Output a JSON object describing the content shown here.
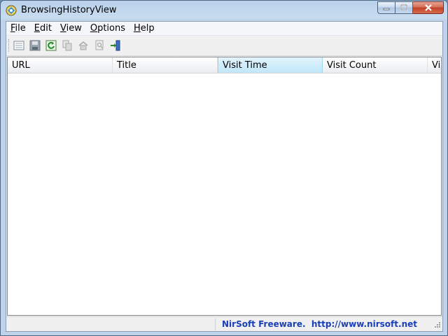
{
  "window": {
    "title": "BrowsingHistoryView"
  },
  "menu": [
    {
      "key": "F",
      "rest": "ile"
    },
    {
      "key": "E",
      "rest": "dit"
    },
    {
      "key": "V",
      "rest": "iew"
    },
    {
      "key": "O",
      "rest": "ptions"
    },
    {
      "key": "H",
      "rest": "elp"
    }
  ],
  "columns": [
    {
      "label": "URL",
      "width": 150
    },
    {
      "label": "Title",
      "width": 150
    },
    {
      "label": "Visit Time",
      "width": 150,
      "selected": true
    },
    {
      "label": "Visit Count",
      "width": 150
    },
    {
      "label": "Visi",
      "width": 80
    }
  ],
  "status": {
    "text": "NirSoft Freeware.  http://www.nirsoft.net"
  },
  "colors": {
    "accent_link": "#1a3fb8",
    "column_selected": "#c8e9f9"
  }
}
